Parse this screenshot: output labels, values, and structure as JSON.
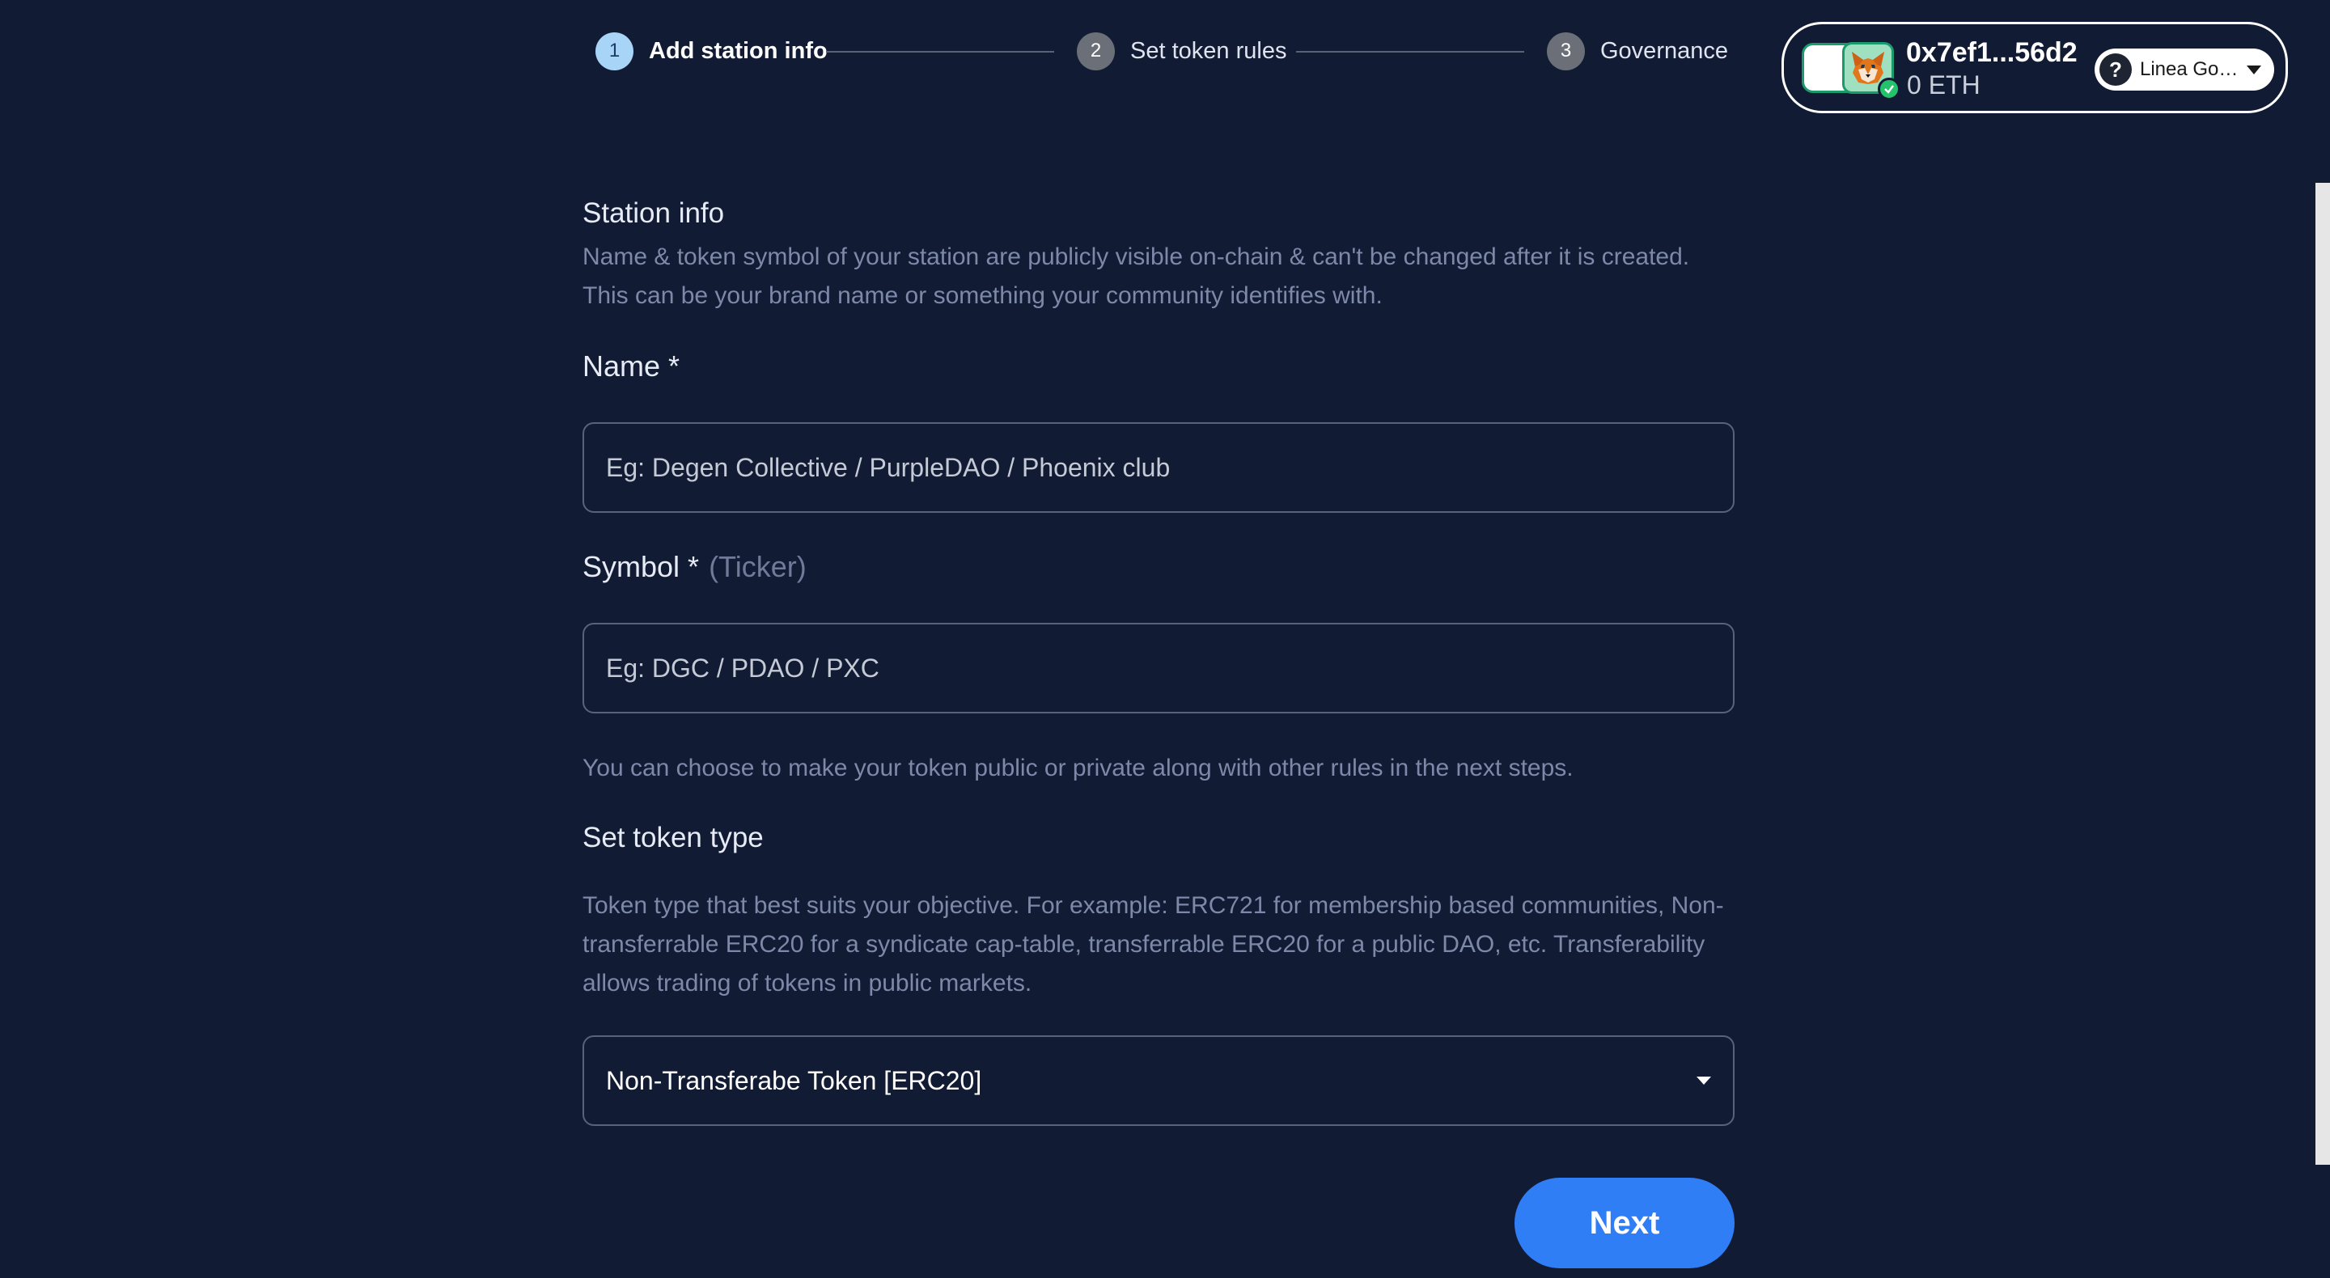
{
  "stepper": {
    "steps": [
      {
        "number": "1",
        "label": "Add station info",
        "active": true
      },
      {
        "number": "2",
        "label": "Set token rules",
        "active": false
      },
      {
        "number": "3",
        "label": "Governance",
        "active": false
      }
    ]
  },
  "wallet": {
    "address": "0x7ef1...56d2",
    "balance": "0 ETH",
    "network": "Linea Goerli",
    "help_glyph": "?",
    "avatar_icon": "metamask-fox-icon",
    "verified_icon": "check-icon"
  },
  "form": {
    "section_title": "Station info",
    "section_description": "Name & token symbol of your station are publicly visible on-chain & can't be changed after it is created. This can be your brand name or something your community identifies with.",
    "name": {
      "label": "Name *",
      "placeholder": "Eg: Degen Collective / PurpleDAO / Phoenix club",
      "value": ""
    },
    "symbol": {
      "label": "Symbol *",
      "sublabel": "(Ticker)",
      "placeholder": "Eg: DGC / PDAO / PXC",
      "value": ""
    },
    "symbol_helper": "You can choose to make your token public or private along with other rules in the next steps.",
    "token_type": {
      "title": "Set token type",
      "description": "Token type that best suits your objective. For example: ERC721 for membership based communities, Non-transferrable ERC20 for a syndicate cap-table, transferrable ERC20 for a public DAO, etc. Transferability allows trading of tokens in public markets.",
      "selected": "Non-Transferabe Token [ERC20]"
    },
    "next_label": "Next"
  },
  "colors": {
    "background": "#121b34",
    "accent": "#2f7ef5",
    "active_step": "#a8d4f7",
    "helper_text": "#7d89a8"
  }
}
